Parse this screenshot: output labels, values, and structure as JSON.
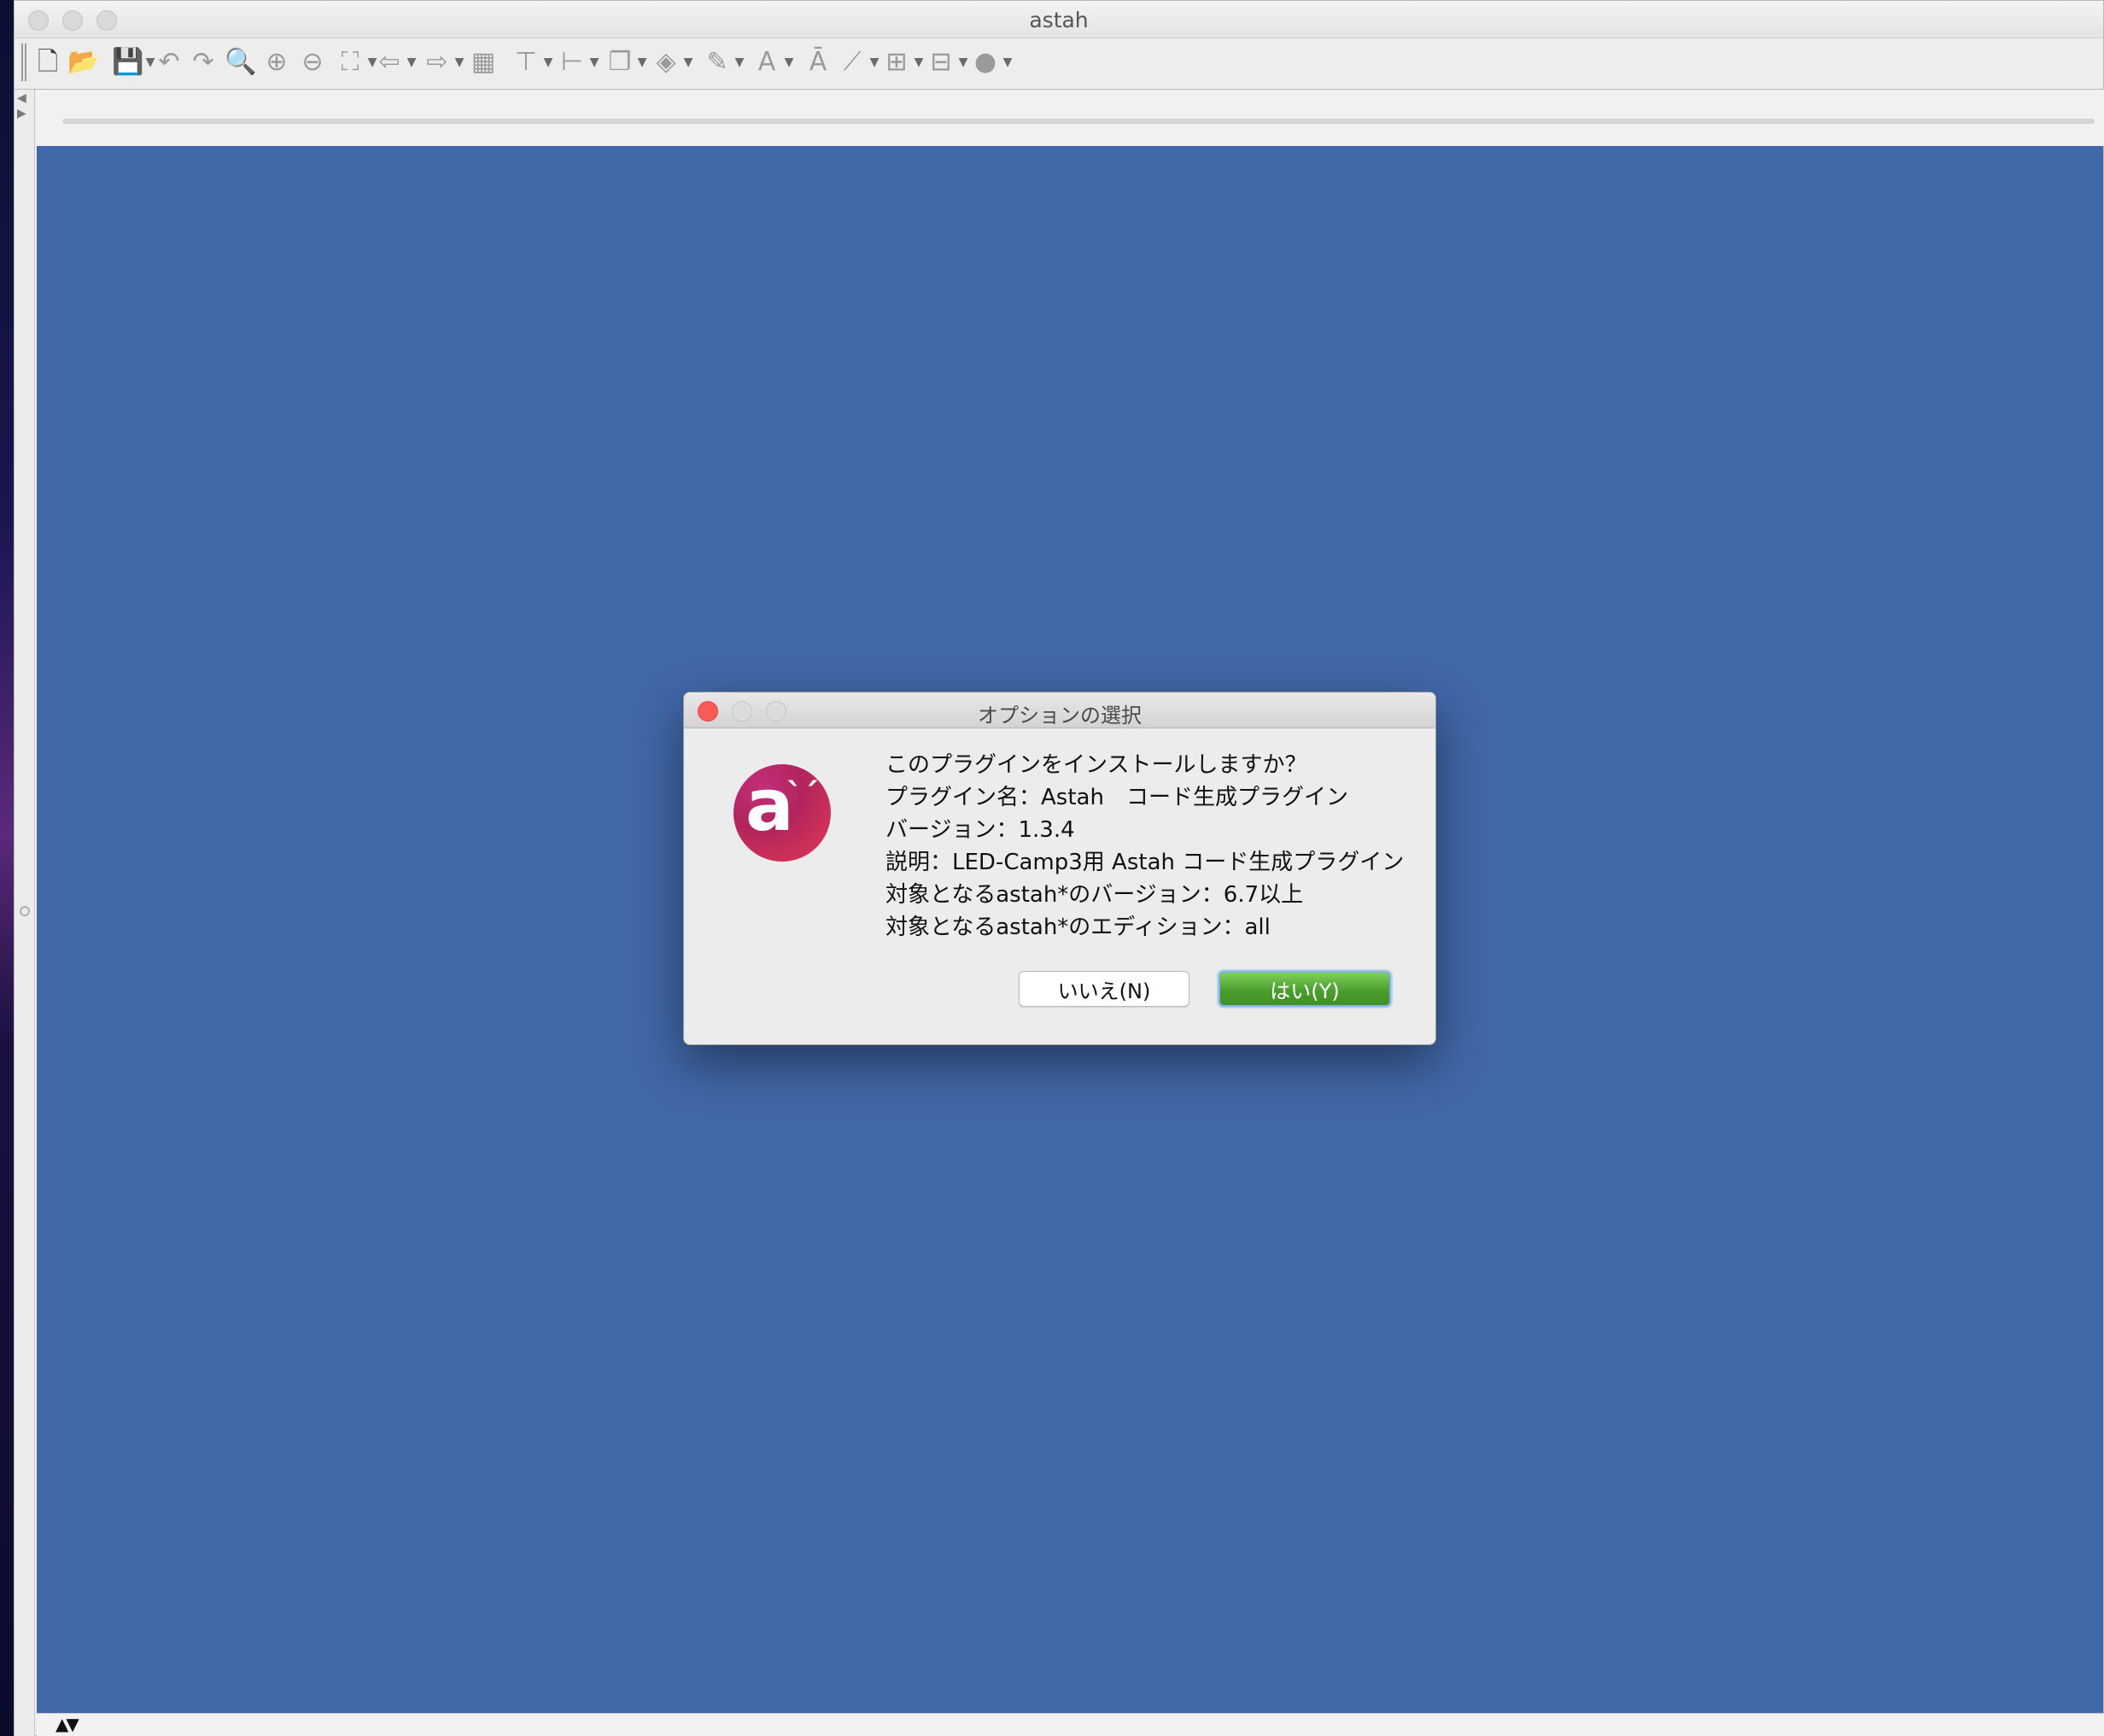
{
  "window": {
    "title": "astah"
  },
  "toolbar": {
    "items": [
      {
        "icon": "new-file-icon",
        "glyph": "🗋"
      },
      {
        "icon": "open-folder-icon",
        "glyph": "📂"
      },
      {
        "icon": "save-icon",
        "glyph": "💾"
      },
      {
        "icon": "undo-icon",
        "glyph": "↶"
      },
      {
        "icon": "redo-icon",
        "glyph": "↷"
      },
      {
        "icon": "zoom-icon",
        "glyph": "🔍"
      },
      {
        "icon": "zoom-in-icon",
        "glyph": "⊕"
      },
      {
        "icon": "zoom-out-icon",
        "glyph": "⊖"
      },
      {
        "icon": "fit-window-icon",
        "glyph": "⛶"
      },
      {
        "icon": "back-icon",
        "glyph": "⇦"
      },
      {
        "icon": "forward-icon",
        "glyph": "⇨"
      },
      {
        "icon": "grid-icon",
        "glyph": "▦"
      },
      {
        "icon": "align-top-icon",
        "glyph": "⊤"
      },
      {
        "icon": "align-left-icon",
        "glyph": "⊢"
      },
      {
        "icon": "arrange-icon",
        "glyph": "❐"
      },
      {
        "icon": "fill-color-icon",
        "glyph": "◈"
      },
      {
        "icon": "line-color-icon",
        "glyph": "✎"
      },
      {
        "icon": "font-color-icon",
        "glyph": "A"
      },
      {
        "icon": "font-size-icon",
        "glyph": "Ā"
      },
      {
        "icon": "line-style-icon",
        "glyph": "⟋"
      },
      {
        "icon": "tree-layout-icon",
        "glyph": "⊞"
      },
      {
        "icon": "auto-layout-icon",
        "glyph": "⊟"
      },
      {
        "icon": "stereotype-icon",
        "glyph": "●"
      }
    ]
  },
  "dialog": {
    "title": "オプションの選択",
    "message_lines": [
      "このプラグインをインストールしますか？",
      "プラグイン名：Astah　コード生成プラグイン",
      "バージョン：1.3.4",
      "説明：LED-Camp3用 Astah コード生成プラグイン",
      "対象となるastah*のバージョン：6.7以上",
      "対象となるastah*のエディション：all"
    ],
    "no_button": "いいえ(N)",
    "yes_button": "はい(Y)",
    "logo_letter": "a"
  },
  "colors": {
    "canvas": "#4168a9",
    "close_button": "#fb5b56",
    "default_button": "#4c9e2f",
    "logo": "#c2307a"
  }
}
